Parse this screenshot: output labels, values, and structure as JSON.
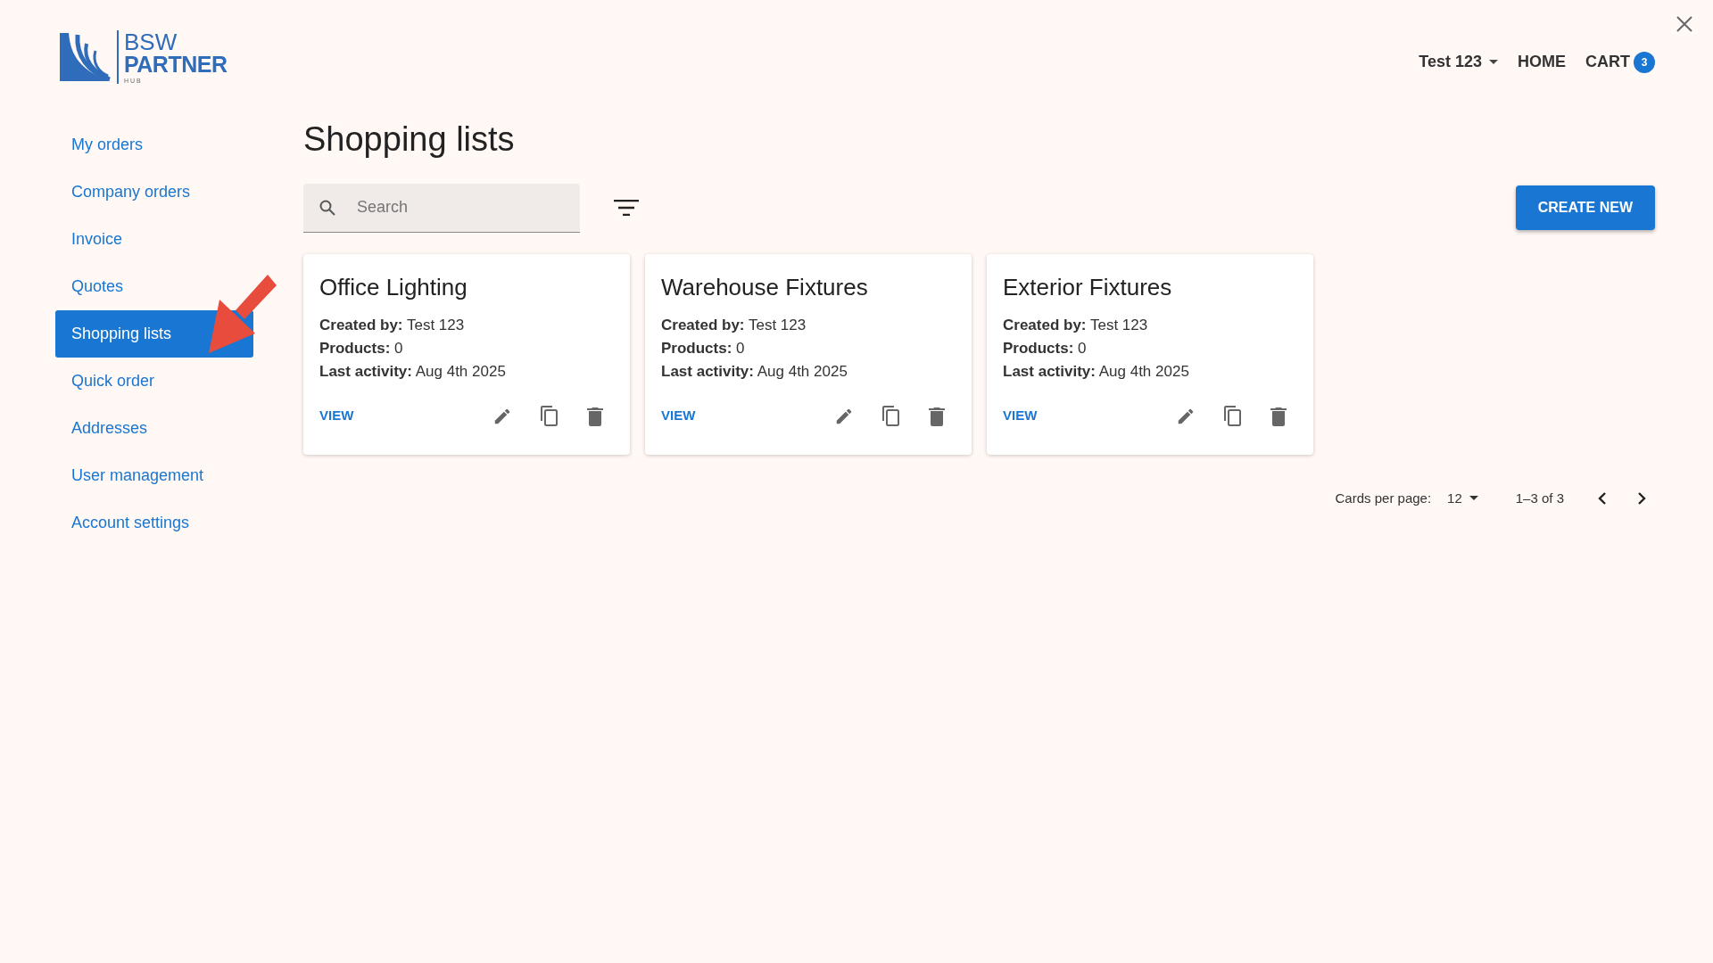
{
  "logo": {
    "line1": "BSW",
    "line2": "PARTNER",
    "line3": "HUB"
  },
  "header": {
    "user": "Test 123",
    "links": [
      {
        "label": "HOME"
      },
      {
        "label": "CART",
        "badge": "3"
      }
    ]
  },
  "sidebar": {
    "items": [
      {
        "label": "My orders",
        "selected": false
      },
      {
        "label": "Company orders",
        "selected": false
      },
      {
        "label": "Invoice",
        "selected": false
      },
      {
        "label": "Quotes",
        "selected": false
      },
      {
        "label": "Shopping lists",
        "selected": true
      },
      {
        "label": "Quick order",
        "selected": false
      },
      {
        "label": "Addresses",
        "selected": false
      },
      {
        "label": "User management",
        "selected": false
      },
      {
        "label": "Account settings",
        "selected": false
      }
    ]
  },
  "page_title": "Shopping lists",
  "search": {
    "placeholder": "Search"
  },
  "create_button": "CREATE NEW",
  "cards": [
    {
      "title": "Office Lighting",
      "fields": [
        {
          "label": "Created by:",
          "value": "Test 123"
        },
        {
          "label": "Products:",
          "value": "0"
        },
        {
          "label": "Last activity:",
          "value": "Aug 4th 2025"
        }
      ],
      "action": "VIEW"
    },
    {
      "title": "Warehouse Fixtures",
      "fields": [
        {
          "label": "Created by:",
          "value": "Test 123"
        },
        {
          "label": "Products:",
          "value": "0"
        },
        {
          "label": "Last activity:",
          "value": "Aug 4th 2025"
        }
      ],
      "action": "VIEW"
    },
    {
      "title": "Exterior Fixtures",
      "fields": [
        {
          "label": "Created by:",
          "value": "Test 123"
        },
        {
          "label": "Products:",
          "value": "0"
        },
        {
          "label": "Last activity:",
          "value": "Aug 4th 2025"
        }
      ],
      "action": "VIEW"
    }
  ],
  "pagination": {
    "label": "Cards per page:",
    "per_page": "12",
    "range": "1–3 of 3"
  }
}
